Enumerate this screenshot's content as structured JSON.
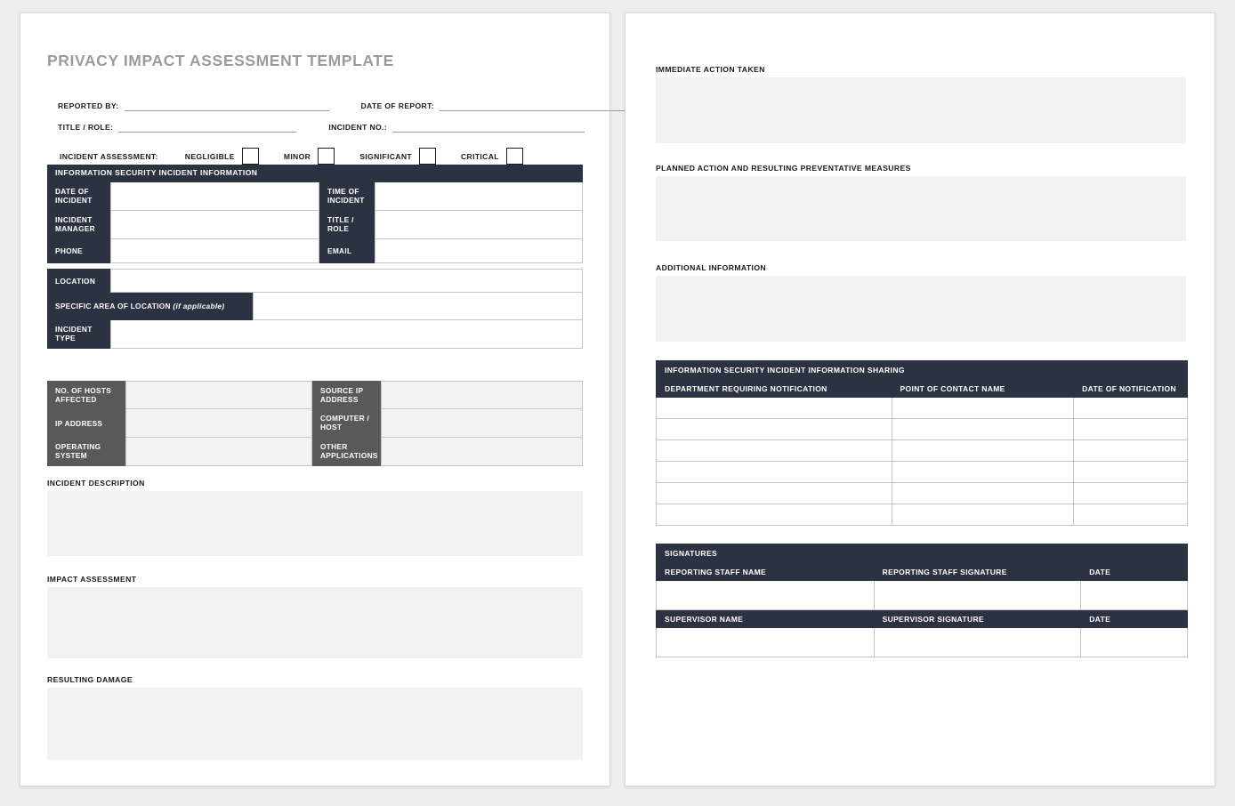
{
  "document": {
    "title": "PRIVACY IMPACT ASSESSMENT TEMPLATE",
    "accent_navy": "#2b3241",
    "accent_gray": "#595959",
    "field_fill": "#f2f2f2",
    "title_color": "#9b9b9b",
    "page_count": 2
  },
  "page1": {
    "meta_fields": [
      {
        "label": "REPORTED BY:",
        "value": ""
      },
      {
        "label": "DATE OF REPORT:",
        "value": ""
      },
      {
        "label": "TITLE / ROLE:",
        "value": ""
      },
      {
        "label": "INCIDENT NO.:",
        "value": ""
      }
    ],
    "incident_assessment": {
      "label": "INCIDENT ASSESSMENT:",
      "options": [
        {
          "label": "NEGLIGIBLE",
          "checked": false
        },
        {
          "label": "MINOR",
          "checked": false
        },
        {
          "label": "SIGNIFICANT",
          "checked": false
        },
        {
          "label": "CRITICAL",
          "checked": false
        }
      ]
    },
    "incident_info": {
      "banner": "INFORMATION SECURITY INCIDENT INFORMATION",
      "paired_rows": [
        {
          "left_label": "DATE OF INCIDENT",
          "left_value": "",
          "right_label": "TIME OF INCIDENT",
          "right_value": ""
        },
        {
          "left_label": "INCIDENT MANAGER",
          "left_value": "",
          "right_label": "TITLE / ROLE",
          "right_value": ""
        },
        {
          "left_label": "PHONE",
          "left_value": "",
          "right_label": "EMAIL",
          "right_value": ""
        }
      ],
      "full_rows": [
        {
          "label": "LOCATION",
          "label_note": "",
          "value": ""
        },
        {
          "label": "SPECIFIC AREA OF LOCATION",
          "label_note": "(if applicable)",
          "value": ""
        },
        {
          "label": "INCIDENT TYPE",
          "label_note": "",
          "value": ""
        }
      ]
    },
    "host_info": {
      "rows": [
        {
          "left_label": "NO. OF HOSTS AFFECTED",
          "left_value": "",
          "right_label": "SOURCE IP ADDRESS",
          "right_value": ""
        },
        {
          "left_label": "IP ADDRESS",
          "left_value": "",
          "right_label": "COMPUTER / HOST",
          "right_value": ""
        },
        {
          "left_label": "OPERATING SYSTEM",
          "left_value": "",
          "right_label": "OTHER APPLICATIONS",
          "right_value": ""
        }
      ]
    },
    "text_blocks": [
      {
        "title": "INCIDENT DESCRIPTION",
        "value": ""
      },
      {
        "title": "IMPACT ASSESSMENT",
        "value": ""
      },
      {
        "title": "RESULTING DAMAGE",
        "value": ""
      }
    ]
  },
  "page2": {
    "text_blocks": [
      {
        "title": "IMMEDIATE ACTION TAKEN",
        "value": ""
      },
      {
        "title": "PLANNED ACTION AND RESULTING PREVENTATIVE MEASURES",
        "value": ""
      },
      {
        "title": "ADDITIONAL INFORMATION",
        "value": ""
      }
    ],
    "sharing_table": {
      "banner": "INFORMATION SECURITY INCIDENT INFORMATION SHARING",
      "columns": [
        "DEPARTMENT REQUIRING NOTIFICATION",
        "POINT OF CONTACT NAME",
        "DATE OF NOTIFICATION"
      ],
      "rows": [
        [
          "",
          "",
          ""
        ],
        [
          "",
          "",
          ""
        ],
        [
          "",
          "",
          ""
        ],
        [
          "",
          "",
          ""
        ],
        [
          "",
          "",
          ""
        ],
        [
          "",
          "",
          ""
        ]
      ]
    },
    "signatures_table": {
      "banner": "SIGNATURES",
      "reporting": {
        "columns": [
          "REPORTING STAFF NAME",
          "REPORTING STAFF SIGNATURE",
          "DATE"
        ],
        "values": [
          "",
          "",
          ""
        ]
      },
      "supervisor": {
        "columns": [
          "SUPERVISOR NAME",
          "SUPERVISOR SIGNATURE",
          "DATE"
        ],
        "values": [
          "",
          "",
          ""
        ]
      }
    }
  }
}
